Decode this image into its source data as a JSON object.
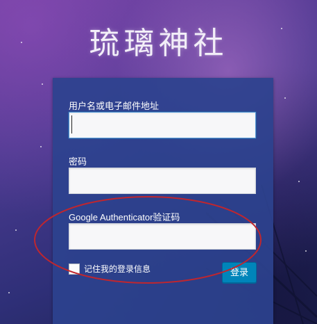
{
  "site": {
    "logo_text": "琉璃神社"
  },
  "form": {
    "username_label": "用户名或电子邮件地址",
    "username_value": "",
    "password_label": "密码",
    "password_value": "",
    "otp_label": "Google Authenticator验证码",
    "otp_value": "",
    "remember_label": "记住我的登录信息",
    "remember_checked": false,
    "submit_label": "登录"
  },
  "annotation": {
    "shape": "ellipse",
    "color": "#c0262e",
    "target": "Google Authenticator验证码 field"
  },
  "colors": {
    "panel": "#2c428e",
    "button": "#0085ba",
    "focus_border": "#5b9dd9"
  }
}
